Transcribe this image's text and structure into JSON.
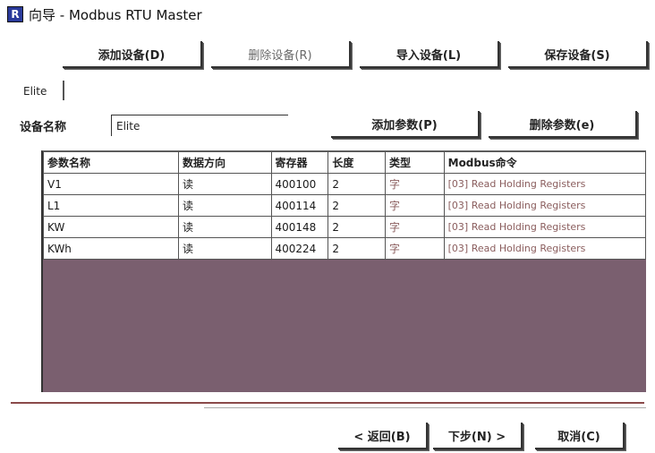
{
  "window": {
    "title": "向导 - Modbus RTU Master",
    "icon_letter": "R"
  },
  "toolbar": {
    "add_device": "添加设备(D)",
    "delete_device": "删除设备(R)",
    "import_device": "导入设备(L)",
    "save_device": "保存设备(S)"
  },
  "tab": {
    "label": "Elite"
  },
  "device": {
    "name_label": "设备名称",
    "name_value": "Elite"
  },
  "params": {
    "add_param": "添加参数(P)",
    "delete_param": "删除参数(e)"
  },
  "table": {
    "headers": [
      "参数名称",
      "数据方向",
      "寄存器",
      "长度",
      "类型",
      "Modbus命令"
    ],
    "rows": [
      [
        "V1",
        "读",
        "400100",
        "2",
        "字",
        "[03] Read Holding Registers"
      ],
      [
        "L1",
        "读",
        "400114",
        "2",
        "字",
        "[03] Read Holding Registers"
      ],
      [
        "KW",
        "读",
        "400148",
        "2",
        "字",
        "[03] Read Holding Registers"
      ],
      [
        "KWh",
        "读",
        "400224",
        "2",
        "字",
        "[03] Read Holding Registers"
      ]
    ]
  },
  "footer": {
    "back": "< 返回(B)",
    "next": "下步(N) >",
    "cancel": "取消(C)"
  }
}
